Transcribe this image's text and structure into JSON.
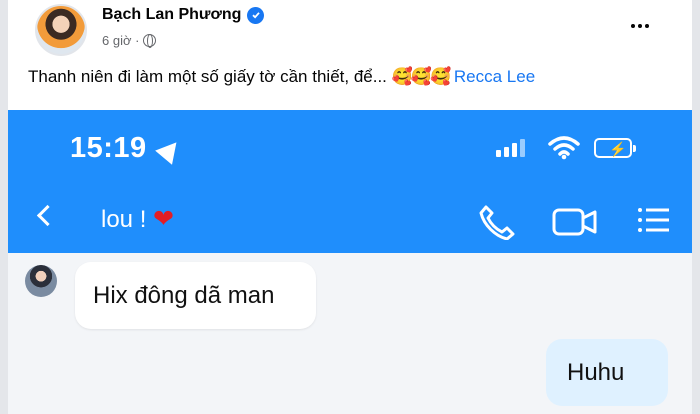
{
  "post": {
    "author": "Bạch Lan Phương",
    "time": "6 giờ ·",
    "caption": "Thanh niên đi làm một số giấy tờ cần thiết, để...",
    "caption_emojis": "🥰🥰🥰",
    "mention": "Recca Lee"
  },
  "embedded_screenshot": {
    "status_time": "15:19",
    "chat_name": "lou !",
    "chat_heart": "❤",
    "messages": [
      {
        "direction": "incoming",
        "text": "Hix đông dã man"
      },
      {
        "direction": "outgoing",
        "text": "Huhu"
      }
    ],
    "icons": [
      "location-arrow-icon",
      "signal-icon",
      "wifi-icon",
      "battery-icon",
      "back-icon",
      "phone-icon",
      "video-icon",
      "list-icon"
    ],
    "colors": {
      "header_blue": "#1f8efc",
      "outgoing_bubble": "#dff1ff",
      "facebook_blue": "#1877f2"
    }
  }
}
